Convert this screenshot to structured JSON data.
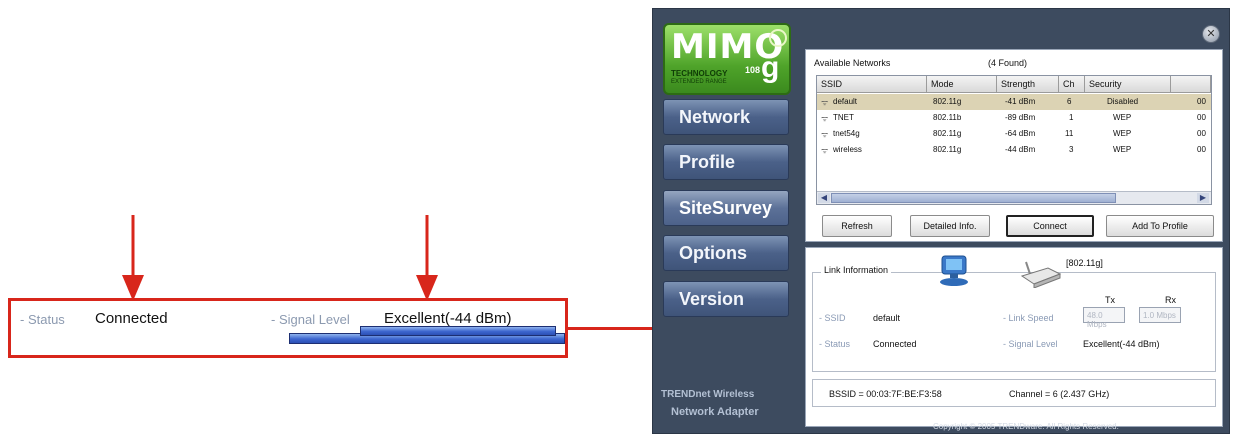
{
  "callout": {
    "status_label": "- Status",
    "status_value": "Connected",
    "signal_label": "- Signal Level",
    "signal_value": "Excellent(-44 dBm)",
    "signal_fraction": 1.0
  },
  "window": {
    "logo": {
      "title": "MIMO",
      "sub": "TECHNOLOGY",
      "sub2": "EXTENDED RANGE",
      "speed": "108",
      "suffix": "g"
    },
    "close_icon": "close-icon",
    "nav": [
      "Network",
      "Profile",
      "SiteSurvey",
      "Options",
      "Version"
    ],
    "active_nav": "SiteSurvey",
    "brand_line1": "TRENDnet Wireless",
    "brand_line2": "Network Adapter",
    "networks": {
      "title": "Available Networks",
      "count": "(4 Found)",
      "columns": [
        "SSID",
        "Mode",
        "Strength",
        "Ch",
        "Security"
      ],
      "rows": [
        {
          "ssid": "default",
          "mode": "802.11g",
          "strength": "-41 dBm",
          "ch": "6",
          "security": "Disabled",
          "extra": "00"
        },
        {
          "ssid": "TNET",
          "mode": "802.11b",
          "strength": "-89 dBm",
          "ch": "1",
          "security": "WEP",
          "extra": "00"
        },
        {
          "ssid": "tnet54g",
          "mode": "802.11g",
          "strength": "-64 dBm",
          "ch": "11",
          "security": "WEP",
          "extra": "00"
        },
        {
          "ssid": "wireless",
          "mode": "802.11g",
          "strength": "-44 dBm",
          "ch": "3",
          "security": "WEP",
          "extra": "00"
        }
      ],
      "buttons": {
        "refresh": "Refresh",
        "detailed": "Detailed Info.",
        "connect": "Connect",
        "add": "Add To Profile"
      }
    },
    "link": {
      "title": "Link Information",
      "standard": "[802.11g]",
      "tx": "Tx",
      "rx": "Rx",
      "ssid_label": "- SSID",
      "ssid_value": "default",
      "status_label": "- Status",
      "status_value": "Connected",
      "link_speed_label": "- Link Speed",
      "tx_speed": "48.0 Mbps",
      "rx_speed": "1.0 Mbps",
      "signal_label": "- Signal Level",
      "signal_value": "Excellent(-44 dBm)",
      "signal_fraction": 1.0,
      "bssid": "BSSID = 00:03:7F:BE:F3:58",
      "channel": "Channel = 6 (2.437 GHz)"
    },
    "copyright": "Copyright © 2005 TRENDware. All Rights Reserved."
  }
}
